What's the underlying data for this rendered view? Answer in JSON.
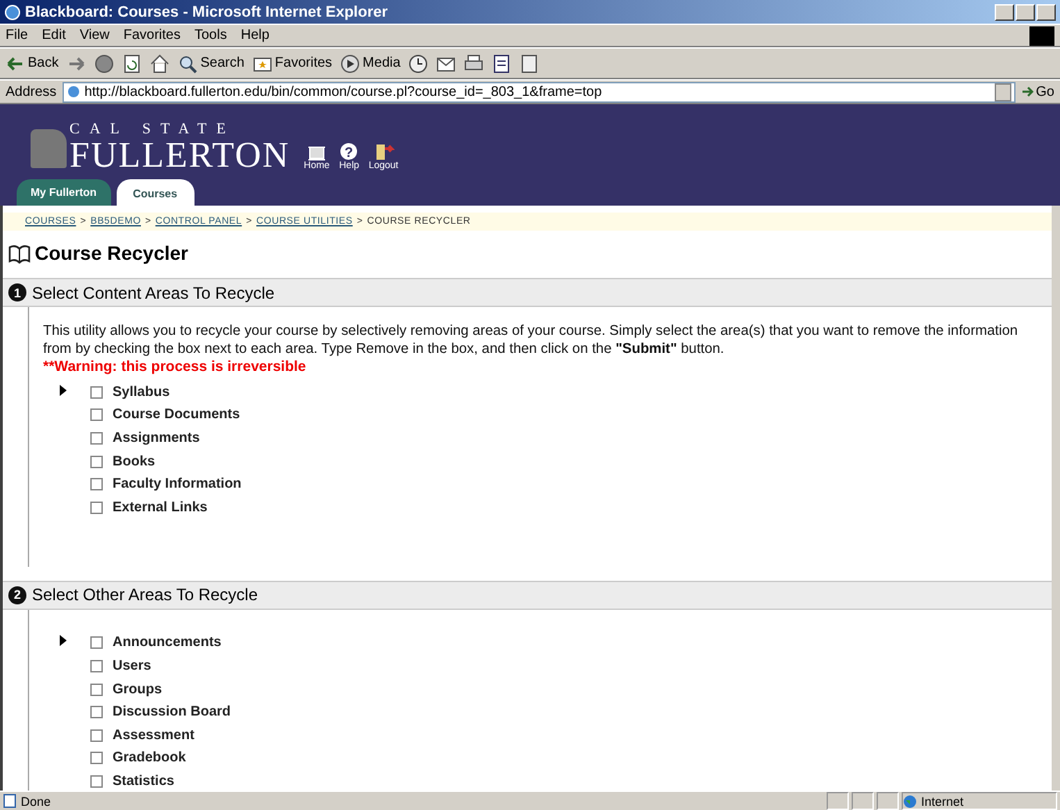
{
  "window": {
    "title": "Blackboard: Courses - Microsoft Internet Explorer"
  },
  "menu": [
    "File",
    "Edit",
    "View",
    "Favorites",
    "Tools",
    "Help"
  ],
  "toolbar": [
    {
      "kind": "back",
      "label": "Back"
    },
    {
      "kind": "forward"
    },
    {
      "kind": "stop"
    },
    {
      "kind": "refresh"
    },
    {
      "kind": "home"
    },
    {
      "kind": "search",
      "label": "Search"
    },
    {
      "kind": "favorites",
      "label": "Favorites"
    },
    {
      "kind": "media",
      "label": "Media"
    },
    {
      "kind": "history"
    },
    {
      "kind": "mail"
    },
    {
      "kind": "print"
    },
    {
      "kind": "edit"
    },
    {
      "kind": "discuss"
    }
  ],
  "address": {
    "label": "Address",
    "value": "http://blackboard.fullerton.edu/bin/common/course.pl?course_id=_803_1&frame=top",
    "go": "Go"
  },
  "banner": {
    "logo_top": "CAL STATE",
    "logo_bottom": "FULLERTON",
    "nav": [
      {
        "kind": "home",
        "label": "Home"
      },
      {
        "kind": "help",
        "label": "Help",
        "glyph": "?"
      },
      {
        "kind": "logout",
        "label": "Logout"
      }
    ]
  },
  "tabs": [
    {
      "label": "My Fullerton",
      "selected": false
    },
    {
      "label": "Courses",
      "selected": true
    }
  ],
  "breadcrumb_separator": ">",
  "breadcrumb": [
    {
      "label": "COURSES",
      "link": true
    },
    {
      "label": "BB5DEMO",
      "link": true
    },
    {
      "label": "CONTROL PANEL",
      "link": true
    },
    {
      "label": "COURSE UTILITIES",
      "link": true
    },
    {
      "label": "COURSE RECYCLER",
      "link": false
    }
  ],
  "page_title": "Course Recycler",
  "sections": [
    {
      "number": "1",
      "heading": "Select Content Areas To Recycle",
      "description": "This utility allows you to recycle your course by selectively removing areas of your course. Simply select the area(s) that you want to remove the information from by checking the box next to each area. Type Remove in the box, and then click on the **\"Submit\"** button.",
      "warning": "**Warning: this process is irreversible",
      "items": [
        {
          "label": "Syllabus",
          "checked": false
        },
        {
          "label": "Course Documents",
          "checked": false
        },
        {
          "label": "Assignments",
          "checked": false
        },
        {
          "label": "Books",
          "checked": false
        },
        {
          "label": "Faculty Information",
          "checked": false
        },
        {
          "label": "External Links",
          "checked": false
        }
      ]
    },
    {
      "number": "2",
      "heading": "Select Other Areas To Recycle",
      "items": [
        {
          "label": "Announcements",
          "checked": false
        },
        {
          "label": "Users",
          "checked": false
        },
        {
          "label": "Groups",
          "checked": false
        },
        {
          "label": "Discussion Board",
          "checked": false
        },
        {
          "label": "Assessment",
          "checked": false
        },
        {
          "label": "Gradebook",
          "checked": false
        },
        {
          "label": "Statistics",
          "checked": false
        }
      ]
    }
  ],
  "status_bar": {
    "text": "Done",
    "zone": "Internet"
  }
}
